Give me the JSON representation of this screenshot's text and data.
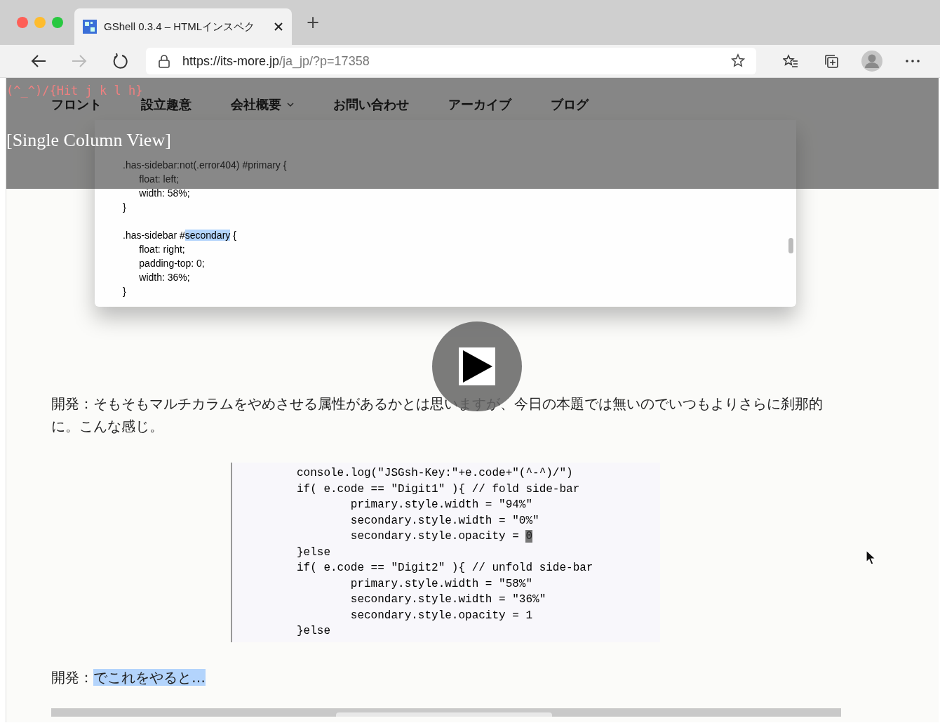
{
  "browser": {
    "tab_title": "GShell 0.3.4 – HTMLインスペク",
    "new_tab": "+",
    "url_host": "https://its-more.jp",
    "url_path": "/ja_jp/?p=17358",
    "forward_disabled": true
  },
  "overlay": {
    "hint": "(^_^)/{Hit j k l h}",
    "nav": [
      {
        "label": "フロント",
        "kind": "link"
      },
      {
        "label": "設立趣意",
        "kind": "link"
      },
      {
        "label": "会社概要",
        "kind": "dropdown"
      },
      {
        "label": "お問い合わせ",
        "kind": "link"
      },
      {
        "label": "アーカイブ",
        "kind": "link"
      },
      {
        "label": "ブログ",
        "kind": "link"
      }
    ],
    "view_label": "[Single Column View]"
  },
  "screenshot_code": [
    [
      [
        {
          "text": ".has-sidebar:not(.error404) #primary {",
          "highlighted": false
        }
      ],
      [
        {
          "text": "      float: left;",
          "highlighted": false
        }
      ],
      [
        {
          "text": "      width: 58%;",
          "highlighted": false
        }
      ],
      [
        {
          "text": "}",
          "highlighted": false
        }
      ]
    ],
    [
      [
        {
          "text": ".has-sidebar #",
          "highlighted": false
        },
        {
          "text": "secondary",
          "highlighted": true
        },
        {
          "text": " {",
          "highlighted": false
        }
      ],
      [
        {
          "text": "      float: right;",
          "highlighted": false
        }
      ],
      [
        {
          "text": "      padding-top: 0;",
          "highlighted": false
        }
      ],
      [
        {
          "text": "      width: 36%;",
          "highlighted": false
        }
      ],
      [
        {
          "text": "}",
          "highlighted": false
        }
      ]
    ]
  ],
  "paragraph_1": [
    {
      "text": "開発：そもそもマルチカラムをやめさせる属性があるかとは思いますが、今日の本題では無いのでいつもよりさらに刹那的に。こんな感じ。",
      "highlighted": false
    }
  ],
  "code_block": [
    [
      {
        "text": "console.log(\"JSGsh-Key:\"+e.code+\"(^-^)/\")",
        "highlighted": false
      }
    ],
    [
      {
        "text": "if( e.code == \"Digit1\" ){ // fold side-bar",
        "highlighted": false
      }
    ],
    [
      {
        "text": "        primary.style.width = \"94%\"",
        "highlighted": false
      }
    ],
    [
      {
        "text": "        secondary.style.width = \"0%\"",
        "highlighted": false
      }
    ],
    [
      {
        "text": "        secondary.style.opacity = ",
        "highlighted": false
      },
      {
        "text": "0",
        "highlighted": true
      }
    ],
    [
      {
        "text": "}else",
        "highlighted": false
      }
    ],
    [
      {
        "text": "if( e.code == \"Digit2\" ){ // unfold side-bar",
        "highlighted": false
      }
    ],
    [
      {
        "text": "        primary.style.width = \"58%\"",
        "highlighted": false
      }
    ],
    [
      {
        "text": "        secondary.style.width = \"36%\"",
        "highlighted": false
      }
    ],
    [
      {
        "text": "        secondary.style.opacity = 1",
        "highlighted": false
      }
    ],
    [
      {
        "text": "}else",
        "highlighted": false
      }
    ]
  ],
  "paragraph_2": [
    {
      "text": "開発：",
      "highlighted": false
    },
    {
      "text": "でこれをやると…",
      "highlighted": true
    }
  ]
}
